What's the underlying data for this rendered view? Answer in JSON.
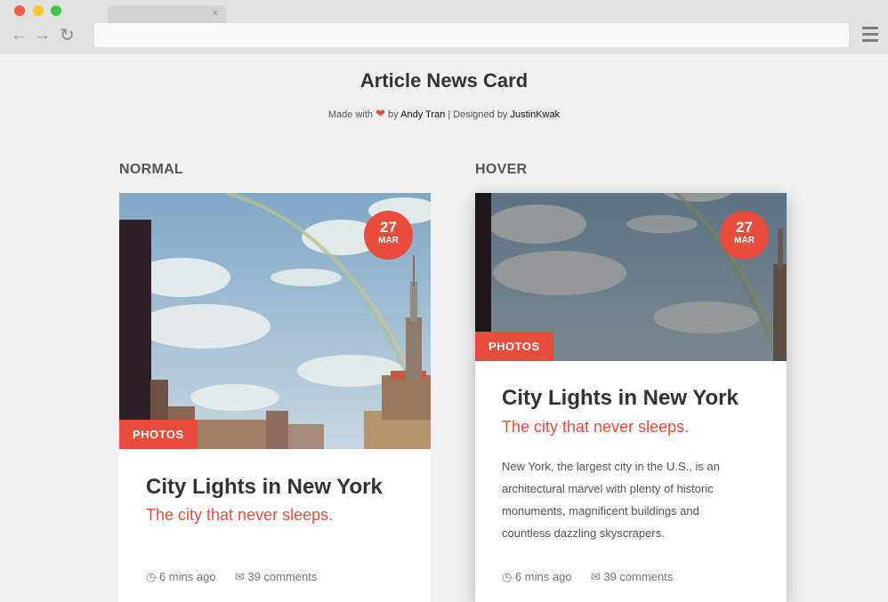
{
  "browser": {
    "tab_close": "×"
  },
  "page": {
    "title": "Article News Card",
    "credits_prefix": "Made with",
    "credits_by": "by",
    "author": "Andy Tran",
    "separator": "| Designed by",
    "designer": "JustinKwak"
  },
  "columns": {
    "normal": "NORMAL",
    "hover": "HOVER"
  },
  "card": {
    "day": "27",
    "month": "MAR",
    "category": "PHOTOS",
    "title": "City Lights in New York",
    "subtitle": "The city that never sleeps.",
    "description": "New York, the largest city in the U.S., is an architectural marvel with plenty of historic monuments, magnificent buildings and countless dazzling skyscrapers.",
    "time": "6 mins ago",
    "comments": "39 comments"
  },
  "colors": {
    "accent": "#e74c3c",
    "background": "#f1f1f1"
  }
}
